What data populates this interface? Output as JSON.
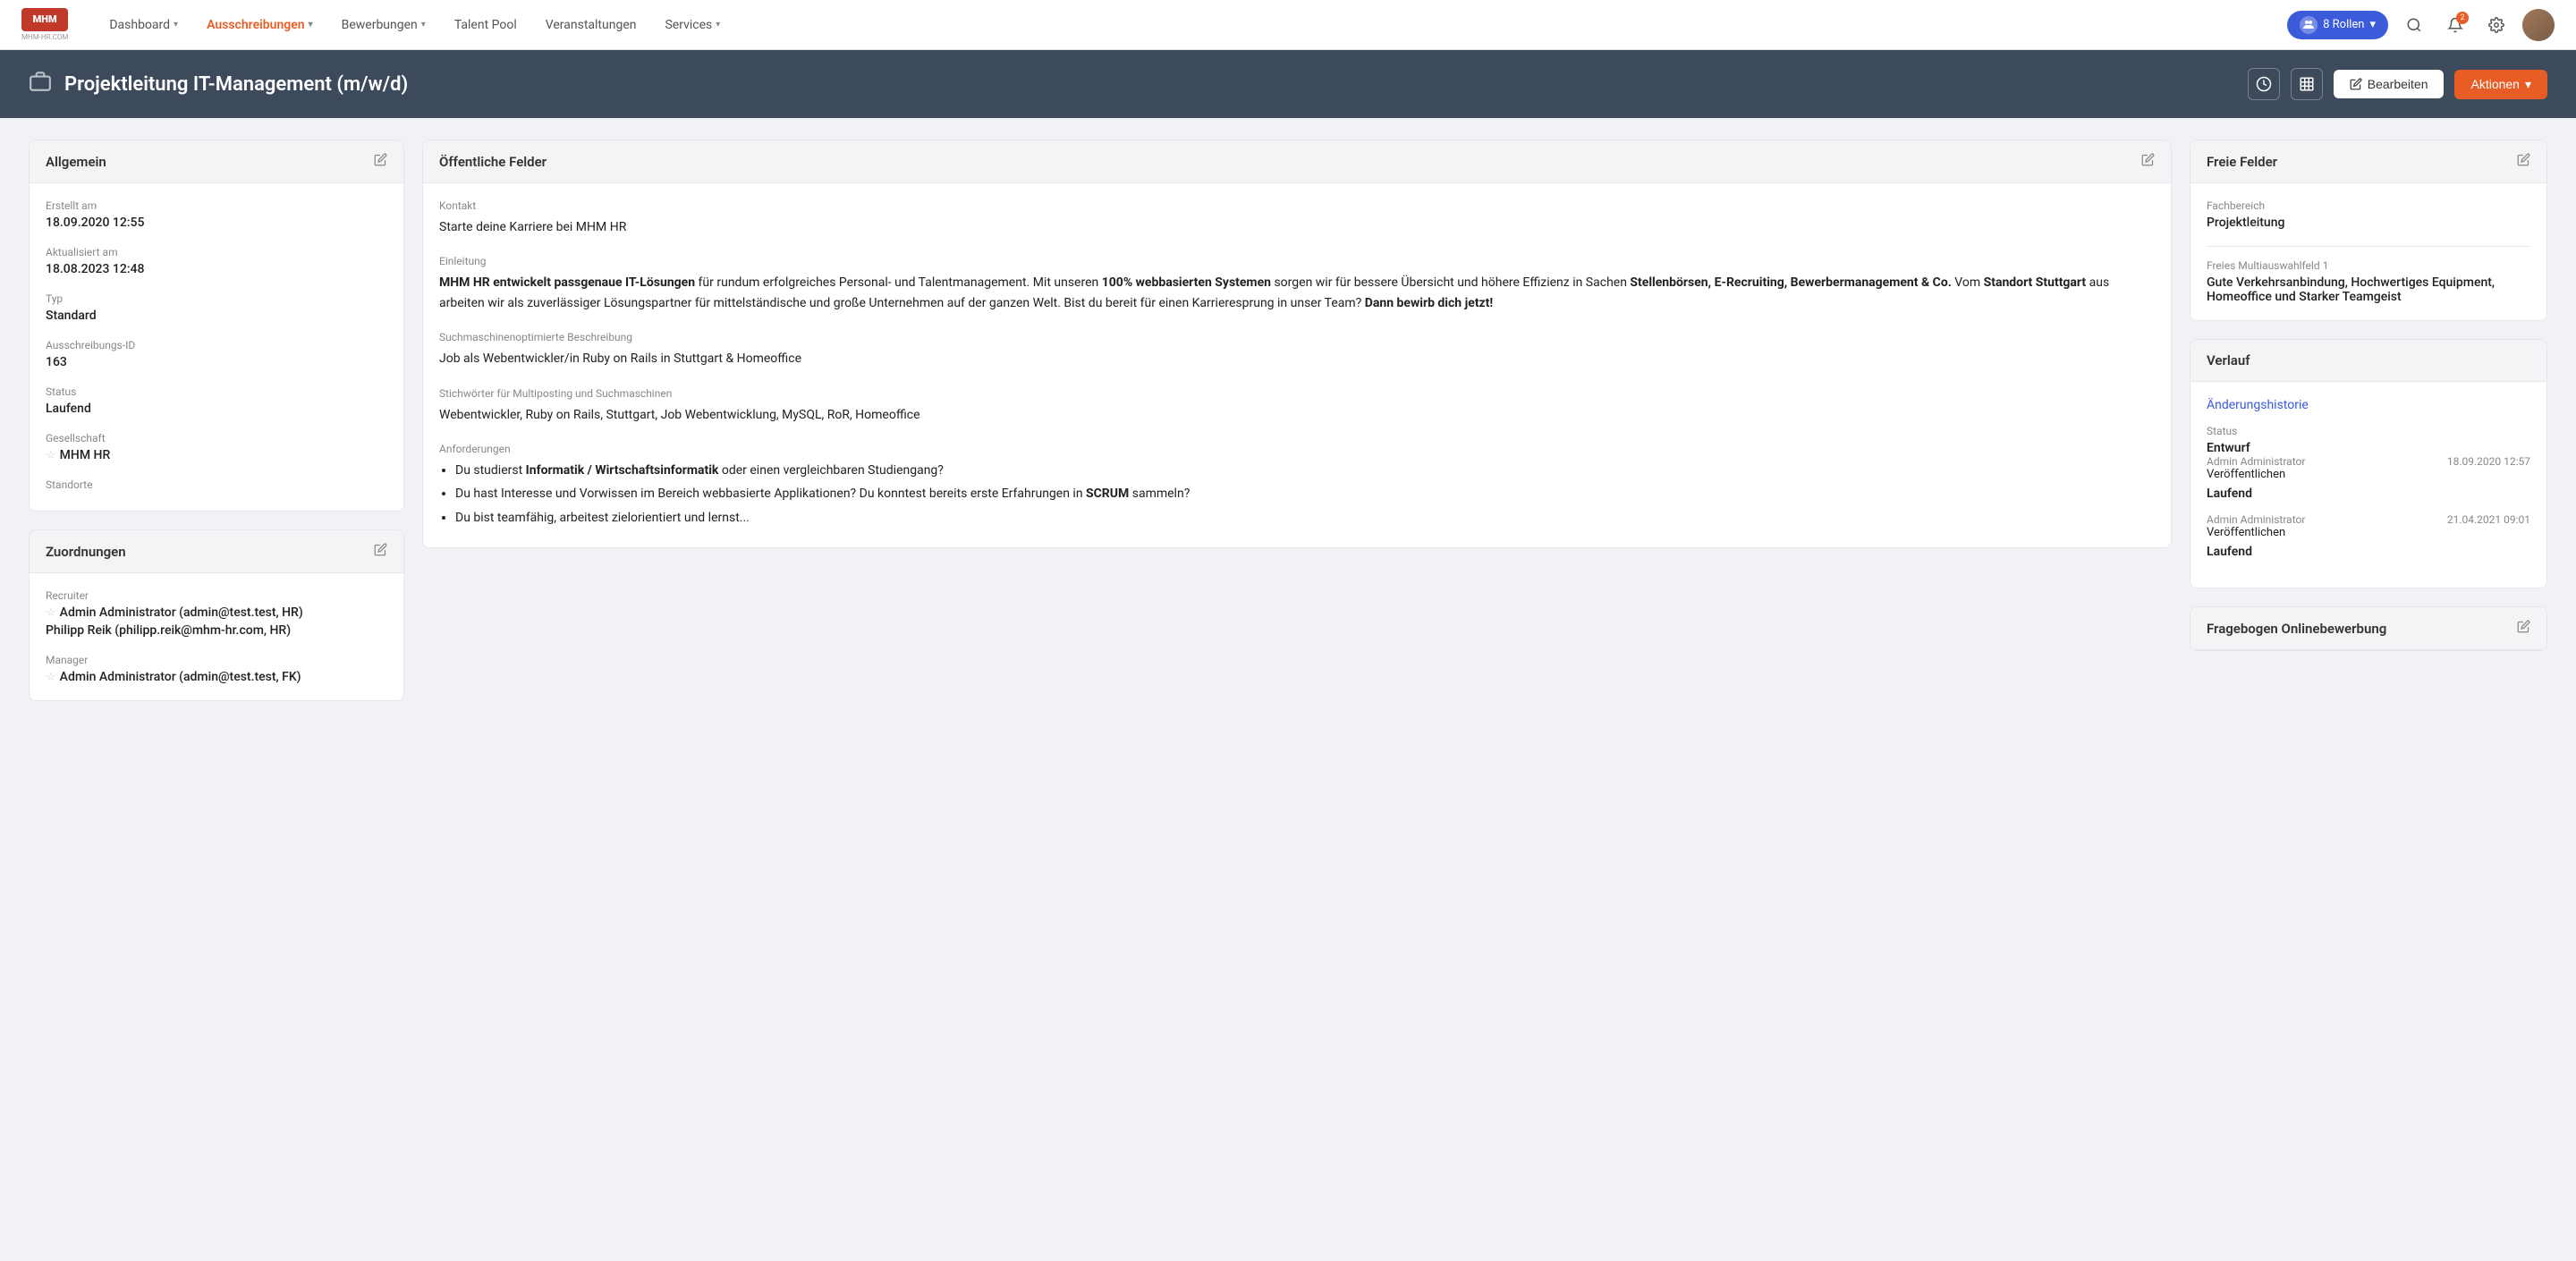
{
  "nav": {
    "logo_line1": "MHM",
    "logo_line2": "MHM-HR.COM",
    "items": [
      {
        "label": "Dashboard",
        "hasChevron": true,
        "active": false
      },
      {
        "label": "Ausschreibungen",
        "hasChevron": true,
        "active": true
      },
      {
        "label": "Bewerbungen",
        "hasChevron": true,
        "active": false
      },
      {
        "label": "Talent Pool",
        "hasChevron": false,
        "active": false
      },
      {
        "label": "Veranstaltungen",
        "hasChevron": false,
        "active": false
      },
      {
        "label": "Services",
        "hasChevron": true,
        "active": false
      }
    ],
    "roles_label": "8 Rollen",
    "notification_count": "2"
  },
  "page_header": {
    "title": "Projektleitung IT-Management (m/w/d)",
    "btn_bearbeiten": "Bearbeiten",
    "btn_aktionen": "Aktionen"
  },
  "allgemein": {
    "title": "Allgemein",
    "erstellt_label": "Erstellt am",
    "erstellt_value": "18.09.2020 12:55",
    "aktualisiert_label": "Aktualisiert am",
    "aktualisiert_value": "18.08.2023 12:48",
    "typ_label": "Typ",
    "typ_value": "Standard",
    "id_label": "Ausschreibungs-ID",
    "id_value": "163",
    "status_label": "Status",
    "status_value": "Laufend",
    "gesellschaft_label": "Gesellschaft",
    "gesellschaft_value": "MHM HR",
    "standorte_label": "Standorte"
  },
  "zuordnungen": {
    "title": "Zuordnungen",
    "recruiter_label": "Recruiter",
    "recruiter_1": "Admin Administrator (admin@test.test, HR)",
    "recruiter_2": "Philipp Reik (philipp.reik@mhm-hr.com, HR)",
    "manager_label": "Manager",
    "manager_1": "Admin Administrator (admin@test.test, FK)"
  },
  "oeffentliche_felder": {
    "title": "Öffentliche Felder",
    "kontakt_label": "Kontakt",
    "kontakt_value": "Starte deine Karriere bei MHM HR",
    "einleitung_label": "Einleitung",
    "einleitung_value": "MHM HR entwickelt passgenaue IT-Lösungen für rundum erfolgreiches Personal- und Talentmanagement. Mit unseren 100% webbasierten Systemen sorgen wir für bessere Übersicht und höhere Effizienz in Sachen Stellenbörsen, E-Recruiting, Bewerbermanagement & Co. Vom Standort Stuttgart aus arbeiten wir als zuverlässiger Lösungspartner für mittelständische und große Unternehmen auf der ganzen Welt. Bist du bereit für einen Karrieresprung in unser Team? Dann bewirb dich jetzt!",
    "suchmaschinen_label": "Suchmaschinenoptimierte Beschreibung",
    "suchmaschinen_value": "Job als Webentwickler/in Ruby on Rails in Stuttgart & Homeoffice",
    "stichwoerter_label": "Stichwörter für Multiposting und Suchmaschinen",
    "stichwoerter_value": "Webentwickler, Ruby on Rails, Stuttgart, Job Webentwicklung, MySQL, RoR, Homeoffice",
    "anforderungen_label": "Anforderungen",
    "anforderungen_items": [
      "Du studierst Informatik / Wirtschaftsinformatik oder einen vergleichbaren Studiengang?",
      "Du hast Interesse und Vorwissen im Bereich webbasierte Applikationen? Du konntest bereits erste Erfahrungen in SCRUM sammeln?",
      "Du bist teamfähig, arbeitest zielorientiert und lernst..."
    ]
  },
  "freie_felder": {
    "title": "Freie Felder",
    "fachbereich_label": "Fachbereich",
    "fachbereich_value": "Projektleitung",
    "multiauswahl_label": "Freies Multiauswahlfeld 1",
    "multiauswahl_value": "Gute Verkehrsanbindung, Hochwertiges Equipment, Homeoffice und Starker Teamgeist"
  },
  "verlauf": {
    "title": "Verlauf",
    "aenderungshistorie_label": "Änderungshistorie",
    "status_label": "Status",
    "entries": [
      {
        "status": "Entwurf",
        "admin": "Admin Administrator",
        "date": "18.09.2020 12:57",
        "action": "Veröffentlichen",
        "result": "Laufend"
      },
      {
        "status": "Laufend",
        "admin": "Admin Administrator",
        "date": "21.04.2021 09:01",
        "action": "Veröffentlichen",
        "result": "Laufend"
      }
    ]
  },
  "fragebogen": {
    "title": "Fragebogen Onlinebewerbung"
  },
  "icons": {
    "edit": "✏",
    "clock": "🕐",
    "table": "▦",
    "pencil": "✎",
    "chevron_down": "▾",
    "search": "🔍",
    "bell": "🔔",
    "gear": "⚙",
    "briefcase": "💼",
    "star": "☆"
  }
}
